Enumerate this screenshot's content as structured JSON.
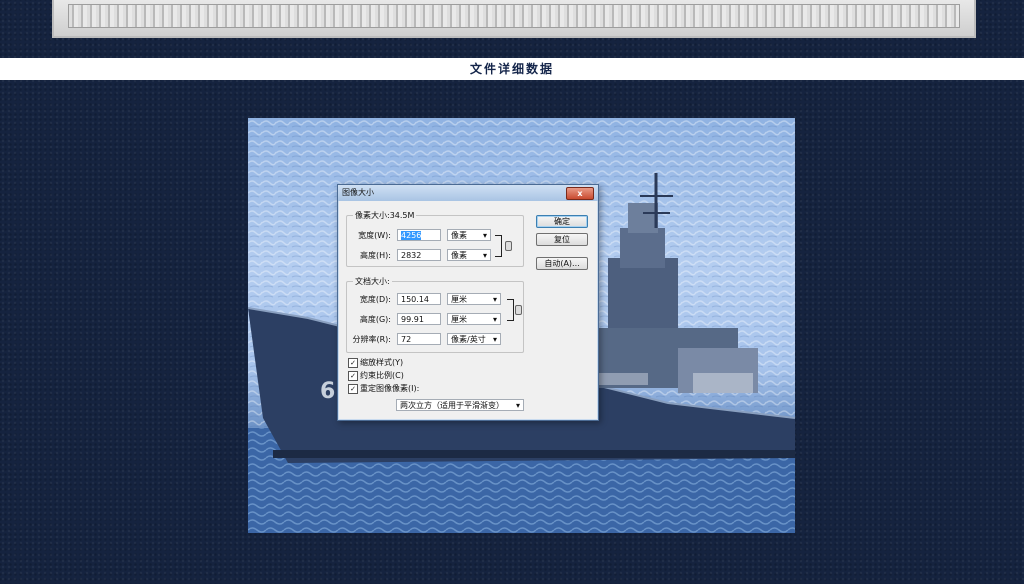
{
  "page": {
    "heading": "文件详细数据"
  },
  "dialog": {
    "title": "图像大小",
    "close_label": "x",
    "pixel_group": {
      "label": "像素大小:34.5M",
      "width": {
        "label": "宽度(W):",
        "value": "4256",
        "unit": "像素"
      },
      "height": {
        "label": "高度(H):",
        "value": "2832",
        "unit": "像素"
      }
    },
    "doc_group": {
      "label": "文档大小:",
      "width": {
        "label": "宽度(D):",
        "value": "150.14",
        "unit": "厘米"
      },
      "height": {
        "label": "高度(G):",
        "value": "99.91",
        "unit": "厘米"
      },
      "resolution": {
        "label": "分辨率(R):",
        "value": "72",
        "unit": "像素/英寸"
      }
    },
    "buttons": {
      "ok": "确定",
      "reset": "复位",
      "auto": "自动(A)..."
    },
    "checkboxes": {
      "scale_styles": "缩放样式(Y)",
      "constrain": "约束比例(C)",
      "resample": "重定图像像素(I):"
    },
    "resample_method": "两次立方（适用于平滑渐变）"
  }
}
